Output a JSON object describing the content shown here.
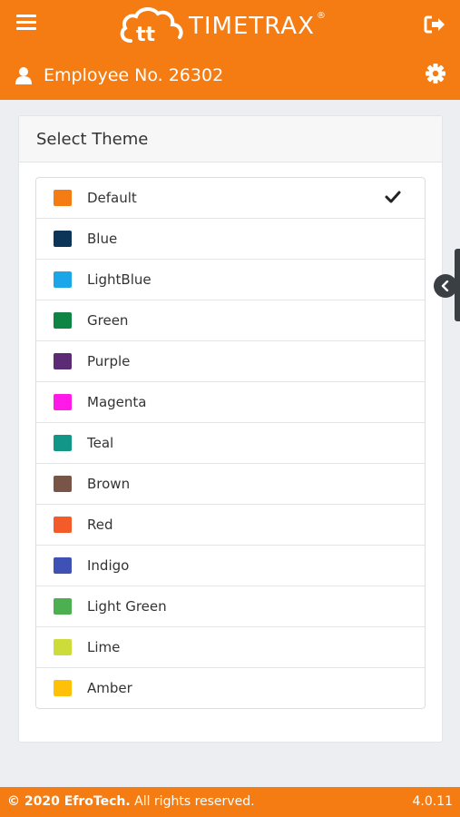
{
  "header": {
    "brand": "TIMETRAX",
    "brand_mark": "®",
    "employee_label": "Employee No. 26302",
    "colors": {
      "primary": "#f57c12"
    }
  },
  "panel": {
    "title": "Select Theme",
    "selected": "Default",
    "themes": [
      {
        "label": "Default",
        "color": "#f57c12"
      },
      {
        "label": "Blue",
        "color": "#0d3557"
      },
      {
        "label": "LightBlue",
        "color": "#1ba6ea"
      },
      {
        "label": "Green",
        "color": "#0f8543"
      },
      {
        "label": "Purple",
        "color": "#5b2b76"
      },
      {
        "label": "Magenta",
        "color": "#ff1ae8"
      },
      {
        "label": "Teal",
        "color": "#119688"
      },
      {
        "label": "Brown",
        "color": "#795548"
      },
      {
        "label": "Red",
        "color": "#f45b29"
      },
      {
        "label": "Indigo",
        "color": "#3f51b5"
      },
      {
        "label": "Light Green",
        "color": "#4caf50"
      },
      {
        "label": "Lime",
        "color": "#cddc39"
      },
      {
        "label": "Amber",
        "color": "#ffc107"
      }
    ]
  },
  "footer": {
    "copyright_bold": "© 2020 EfroTech.",
    "copyright_rest": " All rights reserved.",
    "version": "4.0.11"
  }
}
